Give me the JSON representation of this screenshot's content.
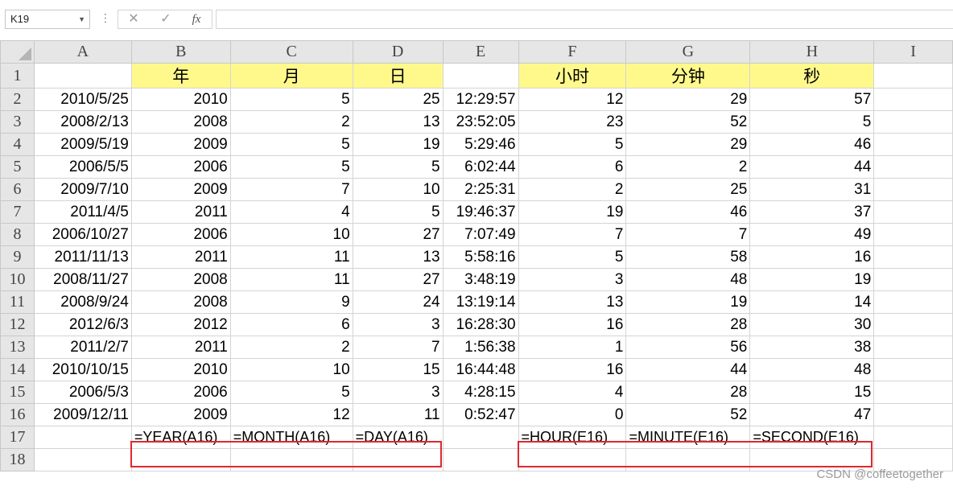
{
  "formula_bar": {
    "name_box": "K19",
    "cancel_symbol": "✕",
    "enter_symbol": "✓",
    "fx_symbol": "fx",
    "formula": ""
  },
  "columns": [
    "A",
    "B",
    "C",
    "D",
    "E",
    "F",
    "G",
    "H",
    "I"
  ],
  "rows": [
    [
      "1",
      "",
      "年",
      "月",
      "日",
      "",
      "小时",
      "分钟",
      "秒",
      ""
    ],
    [
      "2",
      "2010/5/25",
      "2010",
      "5",
      "25",
      "12:29:57",
      "12",
      "29",
      "57",
      ""
    ],
    [
      "3",
      "2008/2/13",
      "2008",
      "2",
      "13",
      "23:52:05",
      "23",
      "52",
      "5",
      ""
    ],
    [
      "4",
      "2009/5/19",
      "2009",
      "5",
      "19",
      "5:29:46",
      "5",
      "29",
      "46",
      ""
    ],
    [
      "5",
      "2006/5/5",
      "2006",
      "5",
      "5",
      "6:02:44",
      "6",
      "2",
      "44",
      ""
    ],
    [
      "6",
      "2009/7/10",
      "2009",
      "7",
      "10",
      "2:25:31",
      "2",
      "25",
      "31",
      ""
    ],
    [
      "7",
      "2011/4/5",
      "2011",
      "4",
      "5",
      "19:46:37",
      "19",
      "46",
      "37",
      ""
    ],
    [
      "8",
      "2006/10/27",
      "2006",
      "10",
      "27",
      "7:07:49",
      "7",
      "7",
      "49",
      ""
    ],
    [
      "9",
      "2011/11/13",
      "2011",
      "11",
      "13",
      "5:58:16",
      "5",
      "58",
      "16",
      ""
    ],
    [
      "10",
      "2008/11/27",
      "2008",
      "11",
      "27",
      "3:48:19",
      "3",
      "48",
      "19",
      ""
    ],
    [
      "11",
      "2008/9/24",
      "2008",
      "9",
      "24",
      "13:19:14",
      "13",
      "19",
      "14",
      ""
    ],
    [
      "12",
      "2012/6/3",
      "2012",
      "6",
      "3",
      "16:28:30",
      "16",
      "28",
      "30",
      ""
    ],
    [
      "13",
      "2011/2/7",
      "2011",
      "2",
      "7",
      "1:56:38",
      "1",
      "56",
      "38",
      ""
    ],
    [
      "14",
      "2010/10/15",
      "2010",
      "10",
      "15",
      "16:44:48",
      "16",
      "44",
      "48",
      ""
    ],
    [
      "15",
      "2006/5/3",
      "2006",
      "5",
      "3",
      "4:28:15",
      "4",
      "28",
      "15",
      ""
    ],
    [
      "16",
      "2009/12/11",
      "2009",
      "12",
      "11",
      "0:52:47",
      "0",
      "52",
      "47",
      ""
    ],
    [
      "17",
      "",
      "=YEAR(A16)",
      "=MONTH(A16)",
      "=DAY(A16)",
      "",
      "=HOUR(E16)",
      "=MINUTE(E16)",
      "=SECOND(E16)",
      ""
    ],
    [
      "18",
      "",
      "",
      "",
      "",
      "",
      "",
      "",
      "",
      ""
    ]
  ],
  "highlight_color": "#fff98c",
  "formula_box_color": "#e0282e",
  "watermark": "CSDN @coffeetogether"
}
